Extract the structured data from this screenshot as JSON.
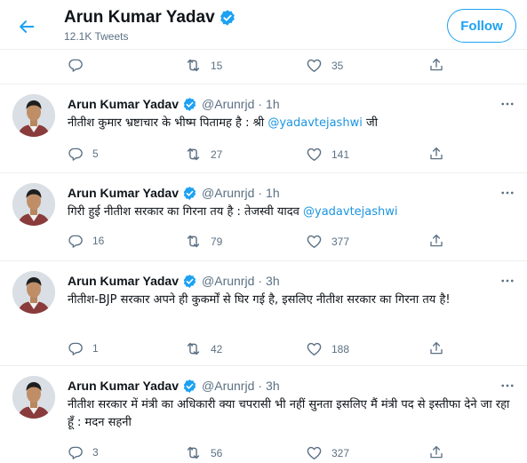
{
  "header": {
    "back_icon": "arrow-left-icon",
    "name": "Arun Kumar Yadav",
    "verified_icon": "verified-badge-icon",
    "tweet_count": "12.1K Tweets",
    "follow_label": "Follow",
    "accent_color": "#1da1f2"
  },
  "top_actions": {
    "reply": "",
    "retweet": "15",
    "like": "35"
  },
  "tweets": [
    {
      "name": "Arun Kumar Yadav",
      "handle": "@Arunrjd",
      "dot": "·",
      "time": "1h",
      "text": "नीतीश कुमार भ्रष्टाचार के भीष्म पितामह है : श्री ",
      "mention": "@yadavtejashwi",
      "text_after": " जी",
      "reply": "5",
      "retweet": "27",
      "like": "141"
    },
    {
      "name": "Arun Kumar Yadav",
      "handle": "@Arunrjd",
      "dot": "·",
      "time": "1h",
      "text": "गिरी हुई नीतीश सरकार का गिरना तय है : तेजस्वी यादव ",
      "mention": "@yadavtejashwi",
      "text_after": "",
      "reply": "16",
      "retweet": "79",
      "like": "377"
    },
    {
      "name": "Arun Kumar Yadav",
      "handle": "@Arunrjd",
      "dot": "·",
      "time": "3h",
      "text": "नीतीश-BJP सरकार अपने ही कुकर्मों से घिर गई है, इसलिए नीतीश सरकार का गिरना तय है!",
      "mention": "",
      "text_after": "",
      "reply": "1",
      "retweet": "42",
      "like": "188"
    },
    {
      "name": "Arun Kumar Yadav",
      "handle": "@Arunrjd",
      "dot": "·",
      "time": "3h",
      "text": "नीतीश सरकार में मंत्री का अधिकारी क्या चपरासी भी नहीं सुनता इसलिए मैं मंत्री पद से इस्तीफा देने जा रहा हूँ : मदन सहनी",
      "mention": "",
      "text_after": "",
      "reply": "3",
      "retweet": "56",
      "like": "327"
    }
  ]
}
